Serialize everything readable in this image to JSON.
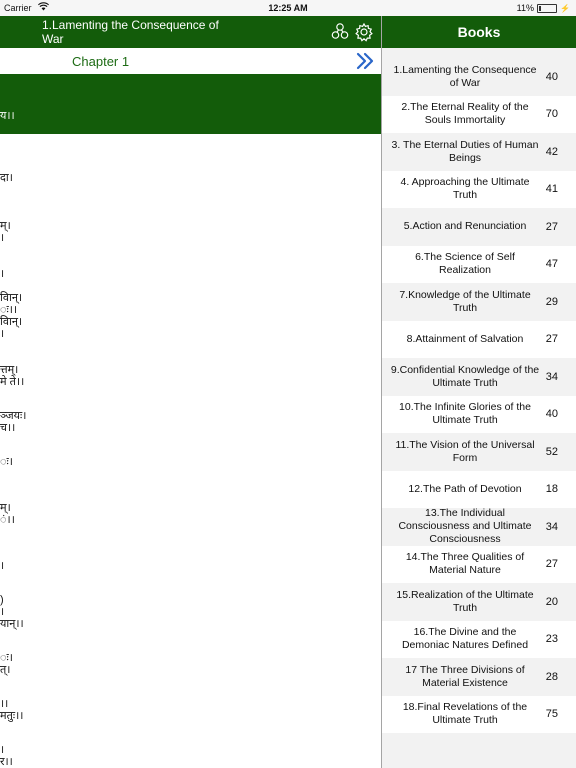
{
  "status_bar": {
    "carrier": "Carrier",
    "time": "12:25 AM",
    "battery": "11%",
    "battery_level": 0.11
  },
  "header": {
    "title": "1.Lamenting the Consequence of War",
    "chapter": "Chapter 1"
  },
  "left_text": {
    "banner": "य।।",
    "lines": [
      "दा।",
      "म्।",
      "।",
      "।",
      "विान्।",
      "ः।।",
      "विान्।",
      "।",
      "त्तम्।",
      "मे ते।।",
      "ञ्जयः।",
      "च।।",
      "ः।",
      "म्।",
      "ं।।",
      "।",
      ")",
      "।",
      "यान्।।",
      "ः।",
      "त्।",
      "।।",
      "मतुः।।",
      "।",
      "र।।"
    ]
  },
  "books": {
    "title": "Books",
    "items": [
      {
        "name": "1.Lamenting the Consequence of War",
        "count": "40"
      },
      {
        "name": "2.The Eternal Reality of the Souls Immortality",
        "count": "70"
      },
      {
        "name": "3. The Eternal Duties of Human Beings",
        "count": "42"
      },
      {
        "name": "4. Approaching the Ultimate Truth",
        "count": "41"
      },
      {
        "name": "5.Action and Renunciation",
        "count": "27"
      },
      {
        "name": "6.The Science of Self Realization",
        "count": "47"
      },
      {
        "name": "7.Knowledge of the Ultimate Truth",
        "count": "29"
      },
      {
        "name": "8.Attainment of Salvation",
        "count": "27"
      },
      {
        "name": "9.Confidential Knowledge of the Ultimate Truth",
        "count": "34"
      },
      {
        "name": "10.The Infinite Glories of the Ultimate Truth",
        "count": "40"
      },
      {
        "name": "11.The Vision of the Universal Form",
        "count": "52"
      },
      {
        "name": "12.The Path of Devotion",
        "count": "18"
      },
      {
        "name": "13.The Individual Consciousness and Ultimate Consciousness",
        "count": "34"
      },
      {
        "name": "14.The Three Qualities of Material Nature",
        "count": "27"
      },
      {
        "name": "15.Realization of the Ultimate Truth",
        "count": "20"
      },
      {
        "name": "16.The Divine and the Demoniac Natures Defined",
        "count": "23"
      },
      {
        "name": "17 The Three Divisions of Material Existence",
        "count": "28"
      },
      {
        "name": "18.Final Revelations of the Ultimate Truth",
        "count": "75"
      }
    ]
  },
  "icons": {
    "share": "share-icon",
    "settings": "gear-icon",
    "next": "double-chevron-right-icon",
    "wifi": "wifi-icon",
    "battery": "battery-icon"
  },
  "colors": {
    "primary": "#135c0a",
    "chapter_text": "#1d6b14",
    "panel_bg": "#f2f2f2"
  }
}
